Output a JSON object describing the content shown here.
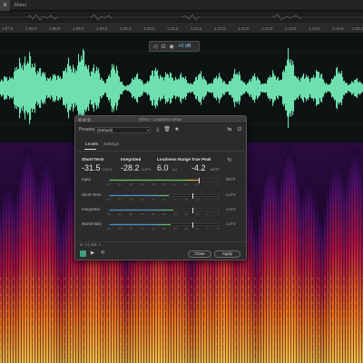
{
  "topbar": {
    "editor_tab": "≡",
    "mixer_tab": "Mixer"
  },
  "ruler": {
    "ticks": [
      "1:07.5",
      "1:08.0",
      "1:08.5",
      "1:09.0",
      "1:09.5",
      "1:10.0",
      "1:10.5",
      "1:11.0",
      "1:11.5",
      "1:12.0",
      "1:12.5",
      "1:13.0",
      "1:13.5",
      "1:14.0",
      "1:14.5",
      "1:15.0"
    ]
  },
  "hud": {
    "volume_value": "+0 dB"
  },
  "dialog": {
    "title": "Effect - Loudness Meter",
    "presets_label": "Presets:",
    "presets_value": "(Default)",
    "tabs": [
      "Levels",
      "Settings"
    ],
    "summary": [
      {
        "label": "Short-Term",
        "value": "-31.5",
        "unit": "LUFS"
      },
      {
        "label": "Integrated",
        "value": "-28.2",
        "unit": "LUFS"
      },
      {
        "label": "Loudness Range",
        "value": "6.0",
        "unit": "LU"
      },
      {
        "label": "True Peak",
        "value": "-4.2",
        "unit": "dBTP"
      }
    ],
    "meters": [
      {
        "label": "Input",
        "unit": "dBTP",
        "fill": 0.82,
        "scale": [
          "-60",
          "-54",
          "-48",
          "-42",
          "-36",
          "-30",
          "-24",
          "-18",
          "-12",
          "-6",
          "0"
        ]
      },
      {
        "label": "Short-Term",
        "unit": "LUFS",
        "fill": 0.54,
        "scale": [
          "-60",
          "-54",
          "-48",
          "-42",
          "-36",
          "-30",
          "-24",
          "-18",
          "-12",
          "-6",
          "0"
        ]
      },
      {
        "label": "Integrated",
        "unit": "LUFS",
        "fill": 0.58,
        "scale": [
          "-60",
          "-54",
          "-48",
          "-42",
          "-36",
          "-30",
          "-24",
          "-18",
          "-12",
          "-6",
          "0"
        ]
      },
      {
        "label": "Momentary",
        "unit": "LUFS",
        "fill": 0.56,
        "scale": [
          "-60",
          "-54",
          "-48",
          "-42",
          "-36",
          "-30",
          "-24",
          "-18",
          "-12",
          "-6",
          "0"
        ]
      }
    ],
    "channels_info": "In: 1 | Out: 1",
    "close_label": "Close",
    "apply_label": "Apply"
  },
  "colors": {
    "waveform": "#6ee0b0",
    "meter_blue": "#3d8edb",
    "meter_green": "#5cc85c",
    "meter_yellow": "#e0c040",
    "accent": "#3f9f7f"
  },
  "icons": {
    "hud": [
      "volume-icon",
      "power-icon"
    ],
    "toolbar": [
      "save-preset-icon",
      "delete-preset-icon",
      "favorite-icon",
      "route-icon",
      "power-icon"
    ],
    "footer": [
      "power-icon",
      "play-icon",
      "loop-icon"
    ]
  }
}
